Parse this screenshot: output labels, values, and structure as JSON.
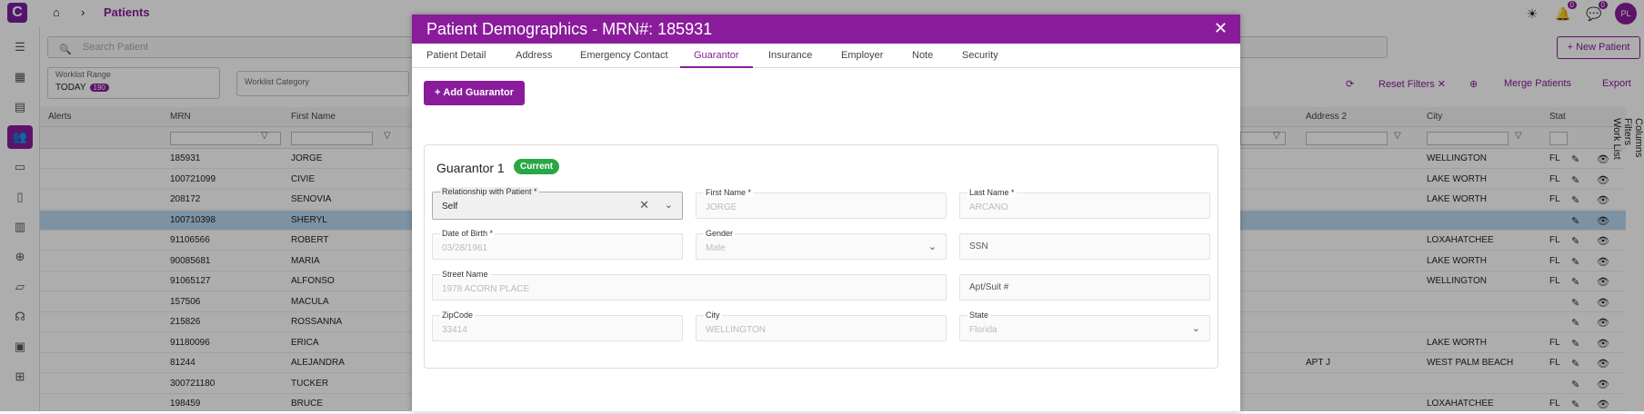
{
  "app": {
    "logo": "C",
    "breadcrumb_title": "Patients"
  },
  "top_icons": {
    "notif_count": "0",
    "msg_count": "0",
    "avatar": "PL"
  },
  "search": {
    "placeholder": "Search Patient"
  },
  "new_patient_label": "+ New Patient",
  "worklist": {
    "range_label": "Worklist Range",
    "range_value": "TODAY",
    "range_count": "190",
    "category_label": "Worklist Category"
  },
  "toolbar": {
    "reset_filters": "Reset Filters",
    "merge_patients": "Merge Patients",
    "export": "Export"
  },
  "grid": {
    "columns": [
      "Alerts",
      "MRN",
      "First Name",
      "Address 2",
      "City",
      "Stat"
    ],
    "rows": [
      {
        "mrn": "185931",
        "first": "JORGE",
        "addr2": "",
        "city": "WELLINGTON",
        "state": "FL",
        "sel": false
      },
      {
        "mrn": "100721099",
        "first": "CIVIE",
        "addr2": "",
        "city": "LAKE WORTH",
        "state": "FL",
        "sel": false
      },
      {
        "mrn": "208172",
        "first": "SENOVIA",
        "addr2": "",
        "city": "LAKE WORTH",
        "state": "FL",
        "sel": false
      },
      {
        "mrn": "100710398",
        "first": "SHERYL",
        "addr2": "",
        "city": "",
        "state": "",
        "sel": true
      },
      {
        "mrn": "91106566",
        "first": "ROBERT",
        "addr2": "",
        "city": "LOXAHATCHEE",
        "state": "FL",
        "sel": false
      },
      {
        "mrn": "90085681",
        "first": "MARIA",
        "addr2": "",
        "city": "LAKE WORTH",
        "state": "FL",
        "sel": false
      },
      {
        "mrn": "91065127",
        "first": "ALFONSO",
        "addr2": "",
        "city": "WELLINGTON",
        "state": "FL",
        "sel": false
      },
      {
        "mrn": "157506",
        "first": "MACULA",
        "addr2": "",
        "city": "",
        "state": "",
        "sel": false
      },
      {
        "mrn": "215826",
        "first": "ROSSANNA",
        "addr2": "",
        "city": "",
        "state": "",
        "sel": false
      },
      {
        "mrn": "91180096",
        "first": "ERICA",
        "addr2": "",
        "city": "LAKE WORTH",
        "state": "FL",
        "sel": false
      },
      {
        "mrn": "81244",
        "first": "ALEJANDRA",
        "addr2": "APT J",
        "city": "WEST PALM BEACH",
        "state": "FL",
        "sel": false
      },
      {
        "mrn": "300721180",
        "first": "TUCKER",
        "addr2": "",
        "city": "",
        "state": "",
        "sel": false
      },
      {
        "mrn": "198459",
        "first": "BRUCE",
        "addr2": "",
        "city": "LOXAHATCHEE",
        "state": "FL",
        "sel": false
      }
    ]
  },
  "side_panel": {
    "columns": "Columns",
    "filters": "Filters",
    "worklist": "Work List"
  },
  "modal": {
    "title": "Patient Demographics - MRN#: 185931",
    "tabs": [
      "Patient Detail",
      "Address",
      "Emergency Contact",
      "Guarantor",
      "Insurance",
      "Employer",
      "Note",
      "Security"
    ],
    "add_guarantor": "Add Guarantor",
    "card_title": "Guarantor 1",
    "status": "Current",
    "fields": {
      "relationship": {
        "label": "Relationship with Patient *",
        "value": "Self"
      },
      "first_name": {
        "label": "First Name *",
        "value": "JORGE"
      },
      "last_name": {
        "label": "Last Name *",
        "value": "ARCANO"
      },
      "dob": {
        "label": "Date of Birth *",
        "value": "03/28/1961"
      },
      "gender": {
        "label": "Gender",
        "value": "Male"
      },
      "ssn": {
        "label": "SSN",
        "value": ""
      },
      "street": {
        "label": "Street Name",
        "value": "1978 ACORN PLACE"
      },
      "apt": {
        "label": "Apt/Suit #",
        "value": ""
      },
      "zip": {
        "label": "ZipCode",
        "value": "33414"
      },
      "city": {
        "label": "City",
        "value": "WELLINGTON"
      },
      "state": {
        "label": "State",
        "value": "Florida"
      }
    }
  },
  "colors": {
    "brand": "#8a1c9c",
    "success": "#28a745",
    "selected_row": "#b9d7ef"
  }
}
